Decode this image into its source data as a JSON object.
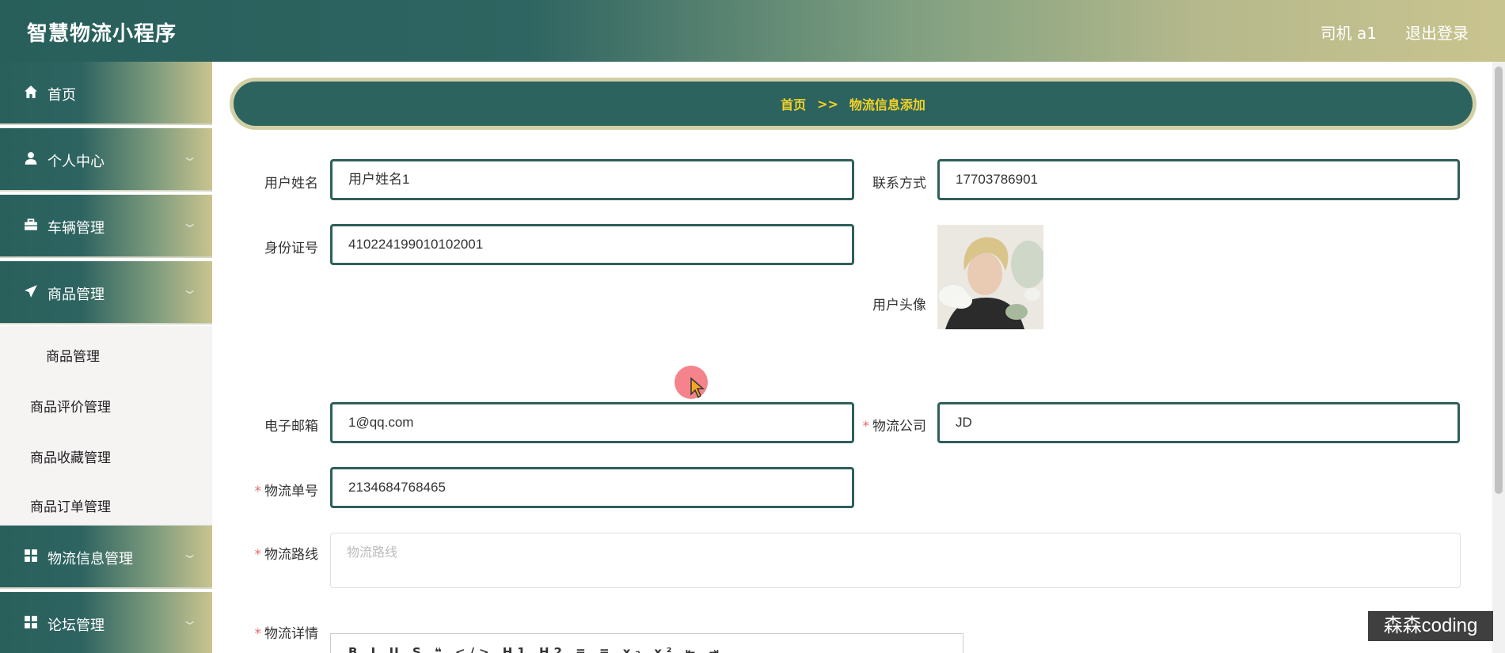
{
  "header": {
    "title": "智慧物流小程序",
    "user": "司机 a1",
    "logout": "退出登录"
  },
  "sidebar": {
    "items": [
      {
        "label": "首页",
        "icon": "home-icon"
      },
      {
        "label": "个人中心",
        "icon": "user-icon"
      },
      {
        "label": "车辆管理",
        "icon": "briefcase-icon"
      },
      {
        "label": "商品管理",
        "icon": "send-icon"
      },
      {
        "label": "物流信息管理",
        "icon": "grid-icon"
      },
      {
        "label": "论坛管理",
        "icon": "grid-icon"
      }
    ],
    "submenu": [
      {
        "label": "商品管理"
      },
      {
        "label": "商品评价管理"
      },
      {
        "label": "商品收藏管理"
      },
      {
        "label": "商品订单管理"
      }
    ]
  },
  "breadcrumb": {
    "home": "首页",
    "separator": ">>",
    "current": "物流信息添加"
  },
  "form": {
    "username_label": "用户姓名",
    "username_value": "用户姓名1",
    "contact_label": "联系方式",
    "contact_value": "17703786901",
    "idcard_label": "身份证号",
    "idcard_value": "410224199010102001",
    "avatar_label": "用户头像",
    "email_label": "电子邮箱",
    "email_value": "1@qq.com",
    "company_label": "物流公司",
    "company_value": "JD",
    "tracking_label": "物流单号",
    "tracking_value": "2134684768465",
    "route_label": "物流路线",
    "route_placeholder": "物流路线",
    "details_label": "物流详情",
    "required_mark": "*"
  },
  "editor": {
    "toolbar": "B  I  U  S  ❝  </>  H1  H2  ≡  ≡  x₂  x²  ⇤  ⇥"
  },
  "watermark": "森森coding",
  "colors": {
    "primary": "#2d635f",
    "accent": "#f2d227",
    "breadcrumb_border": "#d3cfa5",
    "required": "#e56b6b"
  }
}
